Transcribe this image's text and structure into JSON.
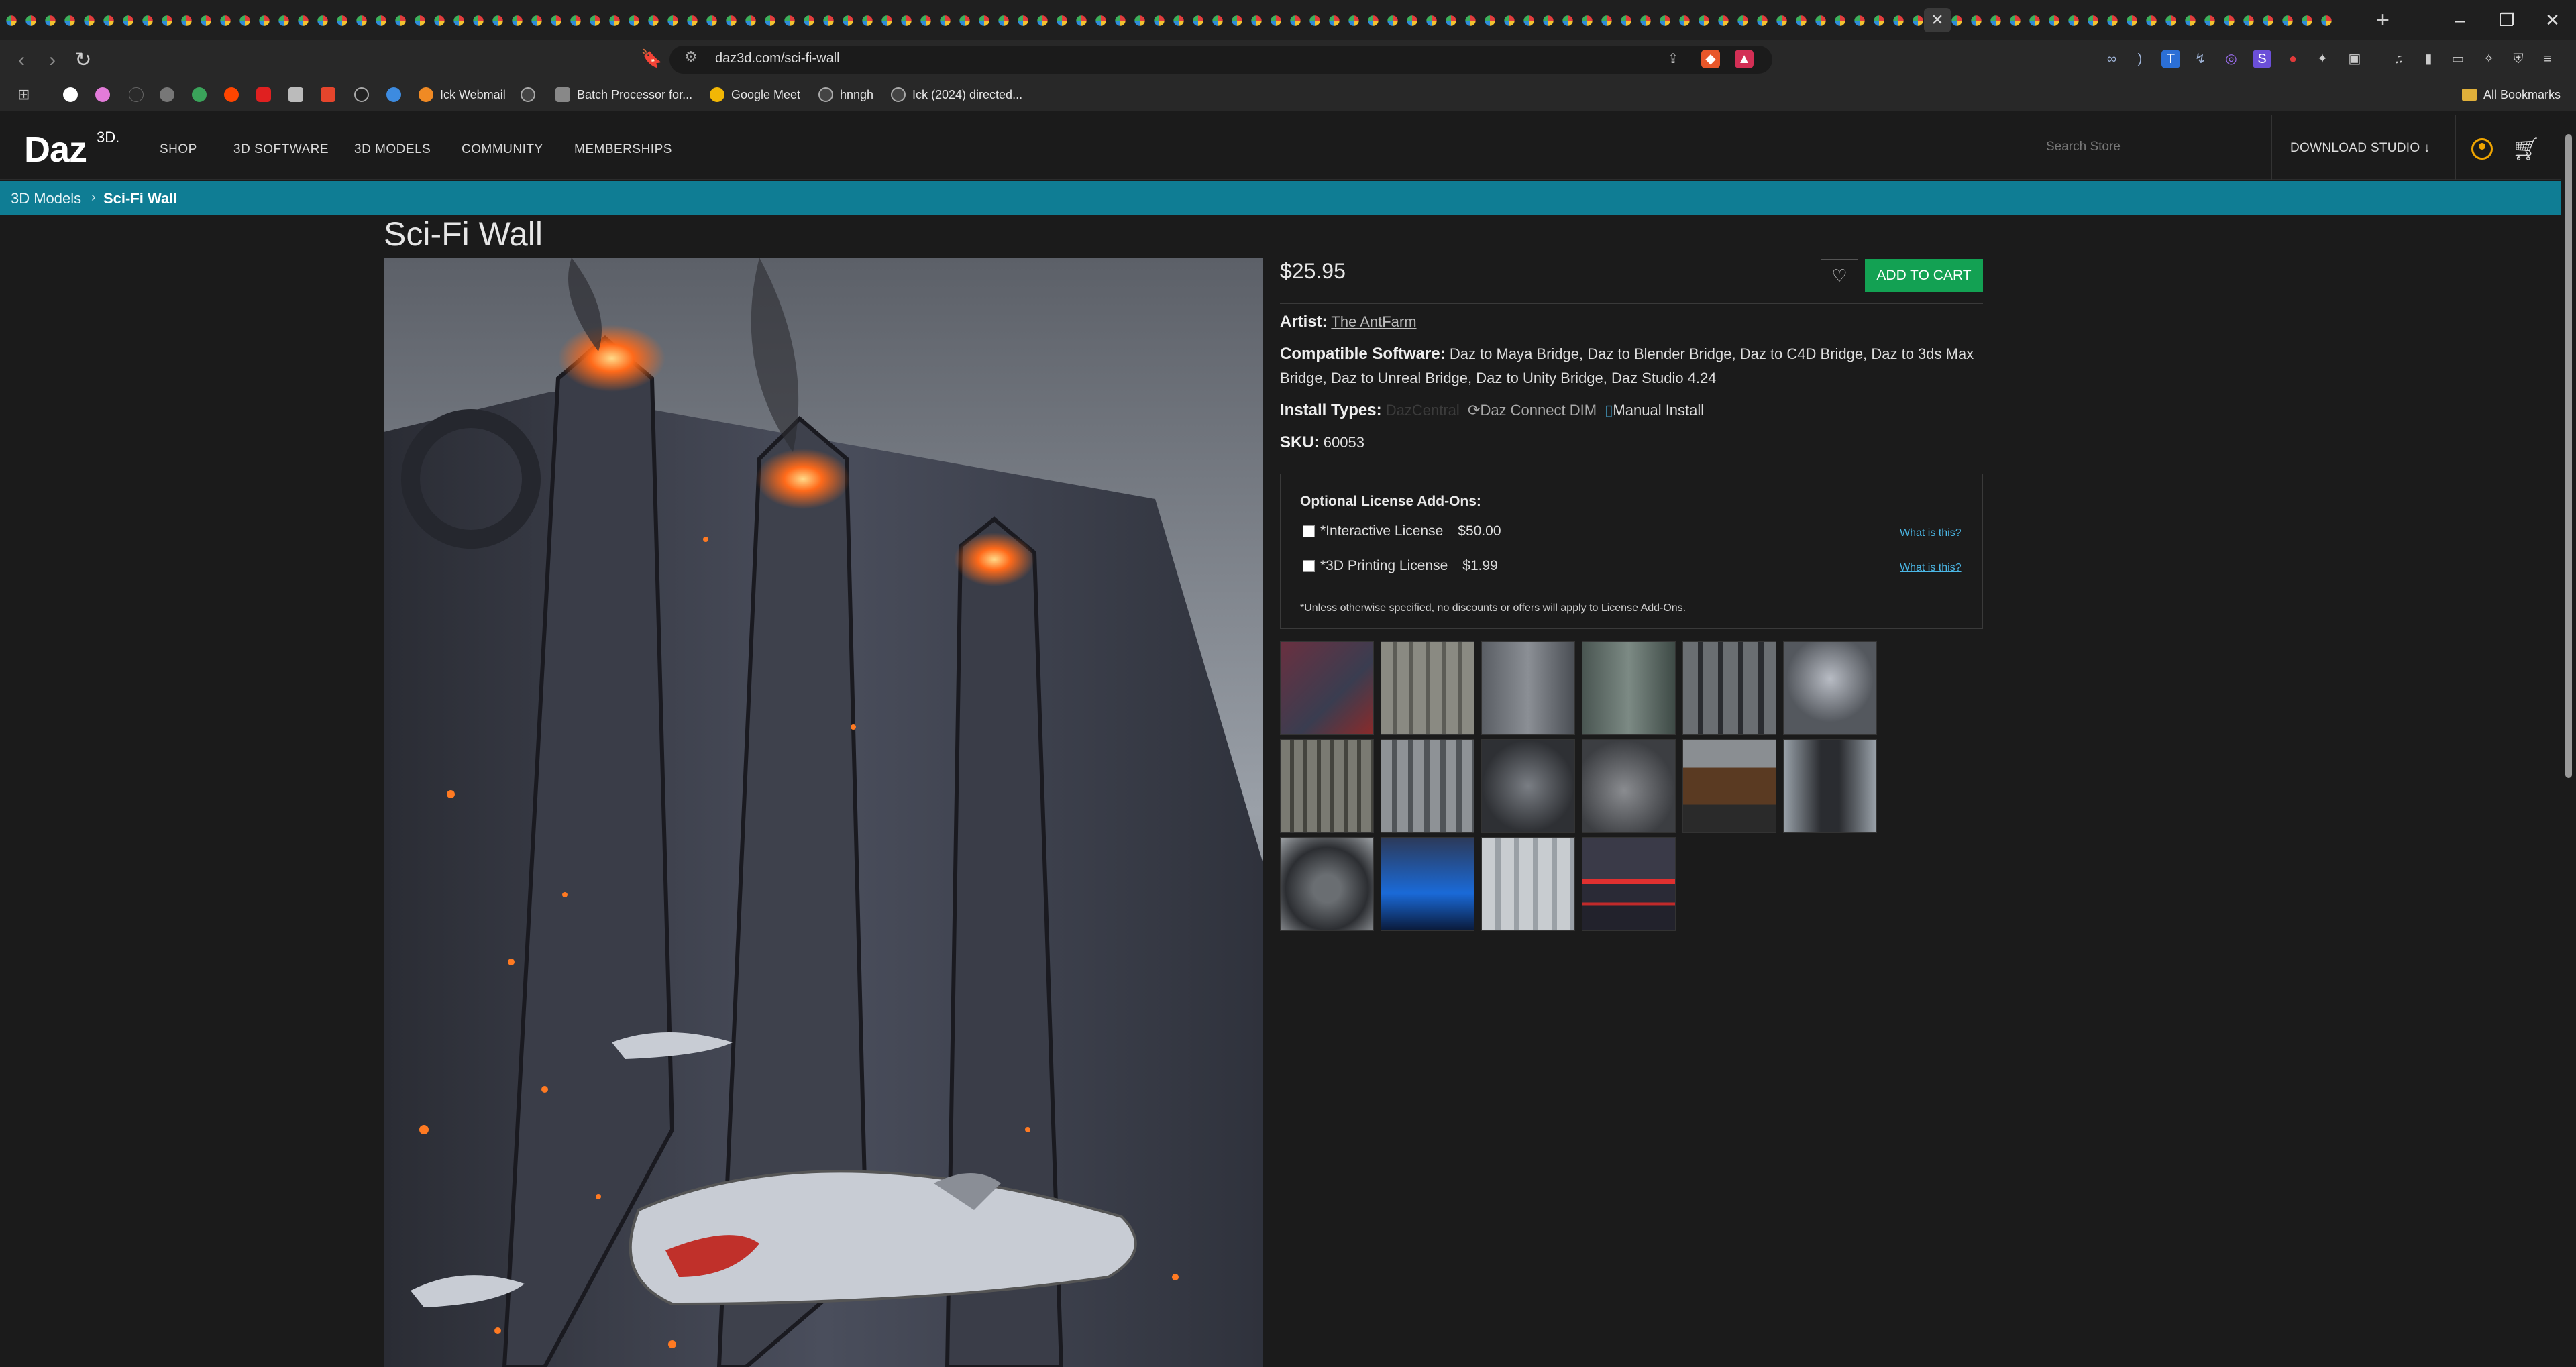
{
  "browser": {
    "url": "daz3d.com/sci-fi-wall",
    "bookmarks": [
      {
        "label": "Ick Webmail"
      },
      {
        "label": "Batch Processor for..."
      },
      {
        "label": "Google Meet"
      },
      {
        "label": "hnngh"
      },
      {
        "label": "Ick (2024) directed..."
      }
    ],
    "all_bookmarks": "All Bookmarks"
  },
  "site": {
    "logo": "Daz",
    "logo_sup": "3D.",
    "nav": [
      "SHOP",
      "3D SOFTWARE",
      "3D MODELS",
      "COMMUNITY",
      "MEMBERSHIPS"
    ],
    "search_placeholder": "Search Store",
    "download_studio": "DOWNLOAD STUDIO ↓"
  },
  "breadcrumb": [
    "3D Models",
    "Sci-Fi Wall"
  ],
  "product": {
    "title": "Sci-Fi Wall",
    "price": "$25.95",
    "add_to_cart": "ADD TO CART",
    "artist_label": "Artist:",
    "artist": "The AntFarm",
    "compat_label": "Compatible Software:",
    "compat": "Daz to Maya Bridge, Daz to Blender Bridge, Daz to C4D Bridge, Daz to 3ds Max Bridge, Daz to Unreal Bridge, Daz to Unity Bridge, Daz Studio 4.24",
    "install_label": "Install Types:",
    "install_faded": "DazCentral",
    "install_types": [
      "Daz Connect",
      "DIM",
      "Manual Install"
    ],
    "sku_label": "SKU:",
    "sku": "60053"
  },
  "license": {
    "title": "Optional License Add-Ons:",
    "items": [
      {
        "name": "*Interactive License",
        "price": "$50.00",
        "link": "What is this?"
      },
      {
        "name": "*3D Printing License",
        "price": "$1.99",
        "link": "What is this?"
      }
    ],
    "note": "*Unless otherwise specified, no discounts or offers will apply to License Add-Ons."
  },
  "colors": {
    "accent_teal": "#0f7d94",
    "cart_green": "#13a153",
    "link_blue": "#4bb7e6"
  }
}
